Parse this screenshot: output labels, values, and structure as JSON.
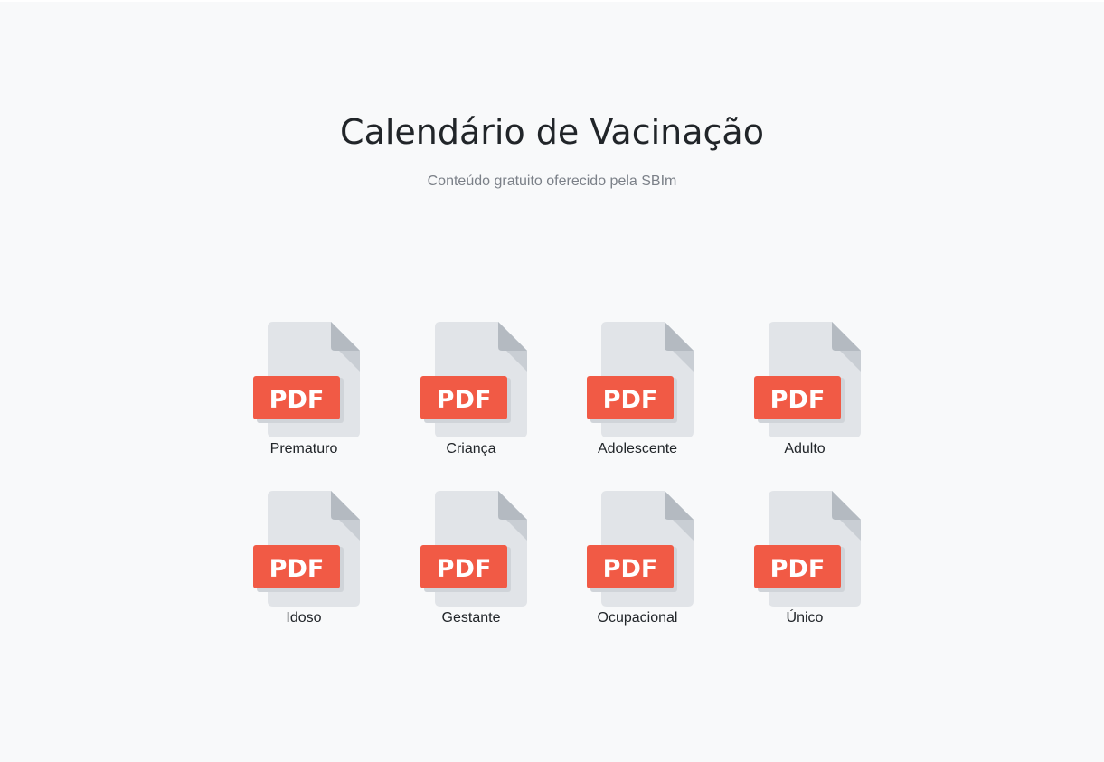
{
  "header": {
    "title": "Calendário de Vacinação",
    "subtitle": "Conteúdo gratuito oferecido pela SBIm"
  },
  "documents": [
    {
      "label": "Prematuro",
      "badge": "PDF",
      "icon": "pdf-file-icon"
    },
    {
      "label": "Criança",
      "badge": "PDF",
      "icon": "pdf-file-icon"
    },
    {
      "label": "Adolescente",
      "badge": "PDF",
      "icon": "pdf-file-icon"
    },
    {
      "label": "Adulto",
      "badge": "PDF",
      "icon": "pdf-file-icon"
    },
    {
      "label": "Idoso",
      "badge": "PDF",
      "icon": "pdf-file-icon"
    },
    {
      "label": "Gestante",
      "badge": "PDF",
      "icon": "pdf-file-icon"
    },
    {
      "label": "Ocupacional",
      "badge": "PDF",
      "icon": "pdf-file-icon"
    },
    {
      "label": "Único",
      "badge": "PDF",
      "icon": "pdf-file-icon"
    }
  ],
  "colors": {
    "background": "#f8f9fa",
    "page_body": "#e1e4e8",
    "page_fold": "#b4bac1",
    "pdf_badge": "#f15a45",
    "pdf_text": "#ffffff",
    "subtitle": "#7b8088"
  }
}
